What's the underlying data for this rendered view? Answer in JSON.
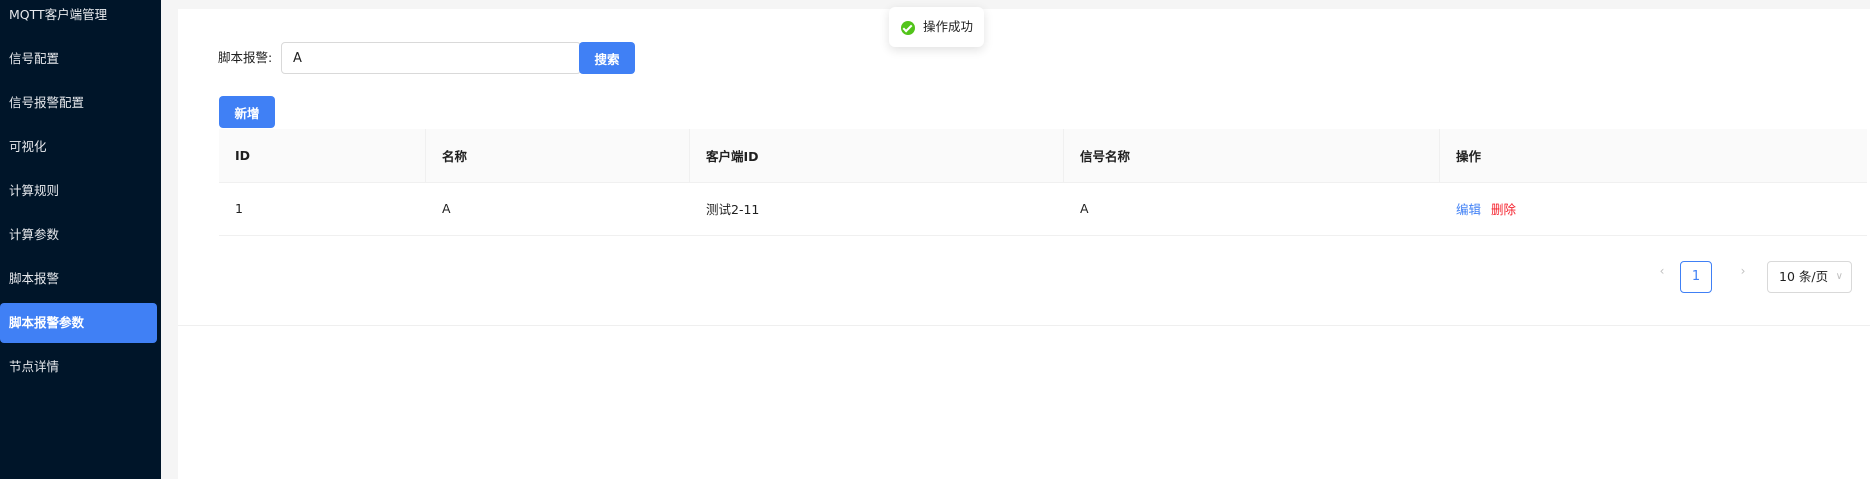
{
  "sidebar": {
    "items": [
      {
        "label": "MQTT客户端管理"
      },
      {
        "label": "信号配置"
      },
      {
        "label": "信号报警配置"
      },
      {
        "label": "可视化"
      },
      {
        "label": "计算规则"
      },
      {
        "label": "计算参数"
      },
      {
        "label": "脚本报警"
      },
      {
        "label": "脚本报警参数",
        "active": true
      },
      {
        "label": "节点详情"
      }
    ]
  },
  "search": {
    "label": "脚本报警:",
    "value": "A",
    "button_label": "搜索"
  },
  "toolbar": {
    "add_label": "新增"
  },
  "table": {
    "columns": [
      "ID",
      "名称",
      "客户端ID",
      "信号名称",
      "操作"
    ],
    "rows": [
      {
        "id": "1",
        "name": "A",
        "client_id": "测试2-11",
        "signal_name": "A",
        "edit": "编辑",
        "delete": "删除"
      }
    ]
  },
  "pagination": {
    "current_page": "1",
    "page_size": "10 条/页"
  },
  "toast": {
    "message": "操作成功"
  },
  "colors": {
    "primary": "#4080f5",
    "sidebar_bg": "#001529",
    "danger": "#f5222d",
    "success": "#52c41a"
  }
}
